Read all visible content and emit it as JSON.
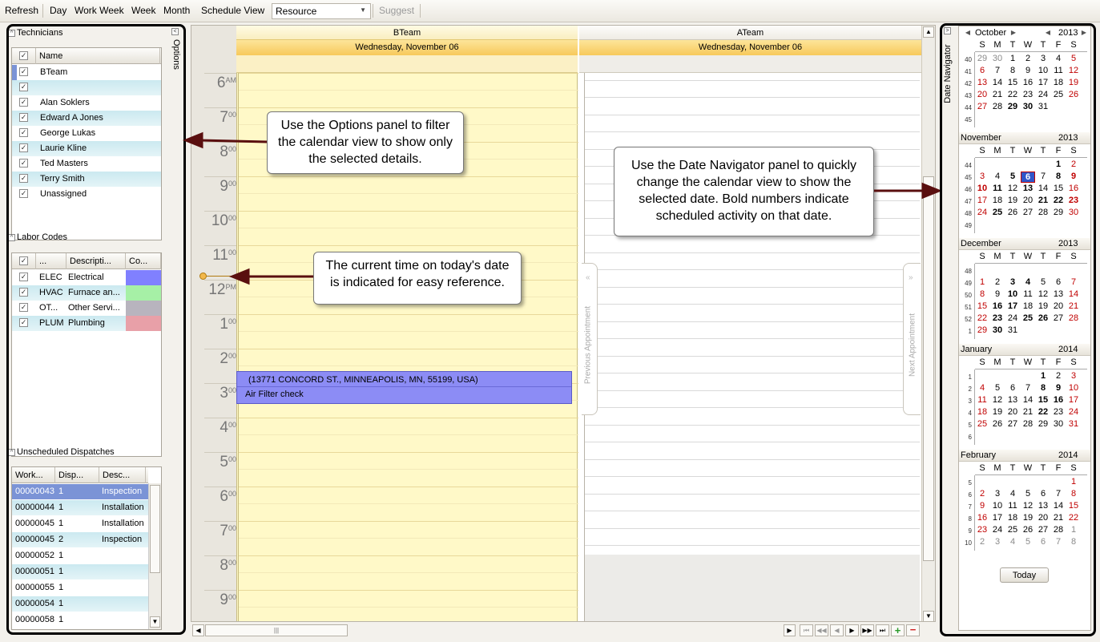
{
  "toolbar": {
    "refresh": "Refresh",
    "day": "Day",
    "work_week": "Work Week",
    "week": "Week",
    "month": "Month",
    "schedule_view": "Schedule View",
    "view_select": "Resource",
    "suggest": "Suggest"
  },
  "options_panel": {
    "vertical_label": "Options",
    "technicians": {
      "title": "Technicians",
      "column": "Name",
      "rows": [
        "BTeam",
        "",
        "Alan Soklers",
        "Edward A Jones",
        "George Lukas",
        "Laurie Kline",
        "Ted Masters",
        "Terry Smith",
        "Unassigned"
      ]
    },
    "labor_codes": {
      "title": "Labor Codes",
      "columns": [
        "...",
        "Descripti...",
        "Co..."
      ],
      "rows": [
        {
          "code": "ELEC",
          "desc": "Electrical",
          "color": "#8080ff"
        },
        {
          "code": "HVAC",
          "desc": "Furnace an...",
          "color": "#a6f0a6"
        },
        {
          "code": "OT...",
          "desc": "Other Servi...",
          "color": "#b8b4be"
        },
        {
          "code": "PLUM",
          "desc": "Plumbing",
          "color": "#e8a0a8"
        }
      ]
    },
    "unscheduled": {
      "title": "Unscheduled Dispatches",
      "columns": [
        "Work...",
        "Disp...",
        "Desc..."
      ],
      "rows": [
        {
          "work": "00000043",
          "disp": "1",
          "desc": "Inspection"
        },
        {
          "work": "00000044",
          "disp": "1",
          "desc": "Installation"
        },
        {
          "work": "00000045",
          "disp": "1",
          "desc": "Installation"
        },
        {
          "work": "00000045",
          "disp": "2",
          "desc": "Inspection"
        },
        {
          "work": "00000052",
          "disp": "1",
          "desc": ""
        },
        {
          "work": "00000051",
          "disp": "1",
          "desc": ""
        },
        {
          "work": "00000055",
          "disp": "1",
          "desc": ""
        },
        {
          "work": "00000054",
          "disp": "1",
          "desc": ""
        },
        {
          "work": "00000058",
          "disp": "1",
          "desc": ""
        }
      ]
    }
  },
  "calendar": {
    "resources": [
      {
        "name": "BTeam",
        "date": "Wednesday, November 06"
      },
      {
        "name": "ATeam",
        "date": "Wednesday, November 06"
      }
    ],
    "hours": [
      {
        "h": "6",
        "s": "AM"
      },
      {
        "h": "7",
        "s": "00"
      },
      {
        "h": "8",
        "s": "00"
      },
      {
        "h": "9",
        "s": "00"
      },
      {
        "h": "10",
        "s": "00"
      },
      {
        "h": "11",
        "s": "00"
      },
      {
        "h": "12",
        "s": "PM"
      },
      {
        "h": "1",
        "s": "00"
      },
      {
        "h": "2",
        "s": "00"
      },
      {
        "h": "3",
        "s": "00"
      },
      {
        "h": "4",
        "s": "00"
      },
      {
        "h": "5",
        "s": "00"
      },
      {
        "h": "6",
        "s": "00"
      },
      {
        "h": "7",
        "s": "00"
      },
      {
        "h": "8",
        "s": "00"
      },
      {
        "h": "9",
        "s": "00"
      }
    ],
    "appointment": {
      "address": "(13771 CONCORD ST., MINNEAPOLIS, MN, 55199, USA)",
      "subject": "Air Filter check"
    },
    "previous_appointment": "Previous Appointment",
    "next_appointment": "Next Appointment"
  },
  "callouts": {
    "options": "Use the Options panel to filter the calendar view to show only the selected details.",
    "current_time": "The current time on today's date is indicated for easy reference.",
    "date_navigator": "Use the Date Navigator panel to quickly change the calendar view to show the selected date. Bold numbers indicate scheduled activity on that date."
  },
  "date_navigator": {
    "vertical_label": "Date Navigator",
    "weekdays": [
      "S",
      "M",
      "T",
      "W",
      "T",
      "F",
      "S"
    ],
    "today_button": "Today",
    "months": [
      {
        "name": "October",
        "year": "2013",
        "weeks": [
          "40",
          "41",
          "42",
          "43",
          "44",
          "45"
        ],
        "days": [
          "29",
          "30",
          "1",
          "2",
          "3",
          "4",
          "5",
          "6",
          "7",
          "8",
          "9",
          "10",
          "11",
          "12",
          "13",
          "14",
          "15",
          "16",
          "17",
          "18",
          "19",
          "20",
          "21",
          "22",
          "23",
          "24",
          "25",
          "26",
          "27",
          "28",
          "29",
          "30",
          "31",
          "",
          "",
          "",
          "",
          "",
          "",
          "",
          "",
          "",
          ""
        ],
        "grey": [
          0,
          1
        ],
        "bold": [
          30,
          31
        ]
      },
      {
        "name": "November",
        "year": "2013",
        "weeks": [
          "44",
          "45",
          "46",
          "47",
          "48",
          "49"
        ],
        "days": [
          "",
          "",
          "",
          "",
          "",
          "1",
          "2",
          "3",
          "4",
          "5",
          "6",
          "7",
          "8",
          "9",
          "10",
          "11",
          "12",
          "13",
          "14",
          "15",
          "16",
          "17",
          "18",
          "19",
          "20",
          "21",
          "22",
          "23",
          "24",
          "25",
          "26",
          "27",
          "28",
          "29",
          "30"
        ],
        "grey": [],
        "bold": [
          5,
          9,
          10,
          12,
          13,
          14,
          15,
          17,
          25,
          26,
          27,
          29
        ],
        "today": 10
      },
      {
        "name": "December",
        "year": "2013",
        "weeks": [
          "48",
          "49",
          "50",
          "51",
          "52",
          "1"
        ],
        "days": [
          "",
          "",
          "",
          "",
          "",
          "",
          "",
          "1",
          "2",
          "3",
          "4",
          "5",
          "6",
          "7",
          "8",
          "9",
          "10",
          "11",
          "12",
          "13",
          "14",
          "15",
          "16",
          "17",
          "18",
          "19",
          "20",
          "21",
          "22",
          "23",
          "24",
          "25",
          "26",
          "27",
          "28",
          "29",
          "30",
          "31"
        ],
        "grey": [],
        "bold": [
          9,
          10,
          16,
          22,
          23,
          29,
          31,
          32,
          36
        ]
      },
      {
        "name": "January",
        "year": "2014",
        "weeks": [
          "1",
          "2",
          "3",
          "4",
          "5",
          "6"
        ],
        "days": [
          "",
          "",
          "",
          "",
          "1",
          "2",
          "3",
          "4",
          "5",
          "6",
          "7",
          "8",
          "9",
          "10",
          "11",
          "12",
          "13",
          "14",
          "15",
          "16",
          "17",
          "18",
          "19",
          "20",
          "21",
          "22",
          "23",
          "24",
          "25",
          "26",
          "27",
          "28",
          "29",
          "30",
          "31"
        ],
        "grey": [],
        "bold": [
          4,
          11,
          12,
          18,
          19,
          25
        ]
      },
      {
        "name": "February",
        "year": "2014",
        "weeks": [
          "5",
          "6",
          "7",
          "8",
          "9",
          "10"
        ],
        "days": [
          "",
          "",
          "",
          "",
          "",
          "",
          "1",
          "2",
          "3",
          "4",
          "5",
          "6",
          "7",
          "8",
          "9",
          "10",
          "11",
          "12",
          "13",
          "14",
          "15",
          "16",
          "17",
          "18",
          "19",
          "20",
          "21",
          "22",
          "23",
          "24",
          "25",
          "26",
          "27",
          "28",
          "1",
          "2",
          "3",
          "4",
          "5",
          "6",
          "7",
          "8"
        ],
        "grey": [
          34,
          35,
          36,
          37,
          38,
          39,
          40,
          41
        ],
        "bold": []
      }
    ]
  }
}
